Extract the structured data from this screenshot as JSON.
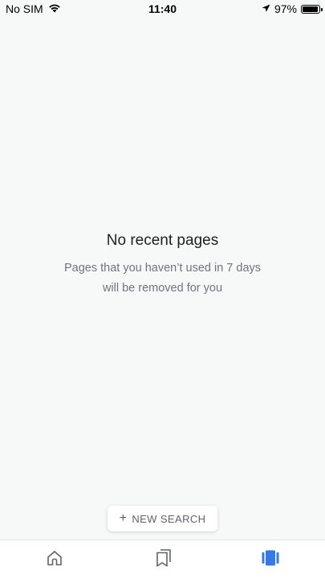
{
  "status_bar": {
    "carrier": "No SIM",
    "time": "11:40",
    "battery_percent": "97%",
    "battery_level": 0.97,
    "icons": [
      "wifi-icon",
      "location-arrow-icon",
      "battery-icon"
    ]
  },
  "empty_state": {
    "title": "No recent pages",
    "subtitle": "Pages that you haven’t used in 7 days will be removed for you"
  },
  "new_search_button": {
    "icon": "+",
    "label": "NEW SEARCH"
  },
  "bottom_nav": {
    "items": [
      {
        "name": "home",
        "icon": "home-icon",
        "active": false
      },
      {
        "name": "collections",
        "icon": "collections-icon",
        "active": false
      },
      {
        "name": "tabs",
        "icon": "tabs-icon",
        "active": true
      }
    ],
    "active_color": "#3a77e0",
    "inactive_color": "#5f6368"
  }
}
